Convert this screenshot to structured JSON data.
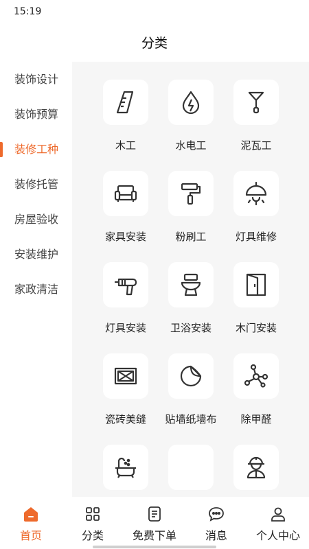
{
  "status_bar": {
    "time": "15:19"
  },
  "page_title": "分类",
  "sidebar": {
    "items": [
      {
        "label": "装饰设计",
        "active": false
      },
      {
        "label": "装饰预算",
        "active": false
      },
      {
        "label": "装修工种",
        "active": true
      },
      {
        "label": "装修托管",
        "active": false
      },
      {
        "label": "房屋验收",
        "active": false
      },
      {
        "label": "安装维护",
        "active": false
      },
      {
        "label": "家政清洁",
        "active": false
      }
    ]
  },
  "grid": {
    "items": [
      {
        "label": "木工",
        "icon": "carpentry-ruler-icon"
      },
      {
        "label": "水电工",
        "icon": "water-electric-icon"
      },
      {
        "label": "泥瓦工",
        "icon": "trowel-icon"
      },
      {
        "label": "家具安装",
        "icon": "sofa-icon"
      },
      {
        "label": "粉刷工",
        "icon": "paint-roller-icon"
      },
      {
        "label": "灯具维修",
        "icon": "ceiling-lamp-icon"
      },
      {
        "label": "灯具安装",
        "icon": "drill-icon"
      },
      {
        "label": "卫浴安装",
        "icon": "toilet-icon"
      },
      {
        "label": "木门安装",
        "icon": "door-icon"
      },
      {
        "label": "瓷砖美缝",
        "icon": "tile-icon"
      },
      {
        "label": "贴墙纸墙布",
        "icon": "wallpaper-icon"
      },
      {
        "label": "除甲醛",
        "icon": "molecule-icon"
      },
      {
        "label": "",
        "icon": "bathtub-icon"
      },
      {
        "label": "",
        "icon": "blank-icon"
      },
      {
        "label": "",
        "icon": "worker-icon"
      }
    ]
  },
  "tabbar": {
    "items": [
      {
        "label": "首页",
        "icon": "home-icon",
        "active": true
      },
      {
        "label": "分类",
        "icon": "category-grid-icon",
        "active": false
      },
      {
        "label": "免费下单",
        "icon": "order-form-icon",
        "active": false
      },
      {
        "label": "消息",
        "icon": "message-bubble-icon",
        "active": false
      },
      {
        "label": "个人中心",
        "icon": "user-profile-icon",
        "active": false
      }
    ]
  },
  "colors": {
    "accent": "#ee6a2c",
    "content_bg": "#f6f6f6",
    "icon_stroke": "#333333"
  }
}
